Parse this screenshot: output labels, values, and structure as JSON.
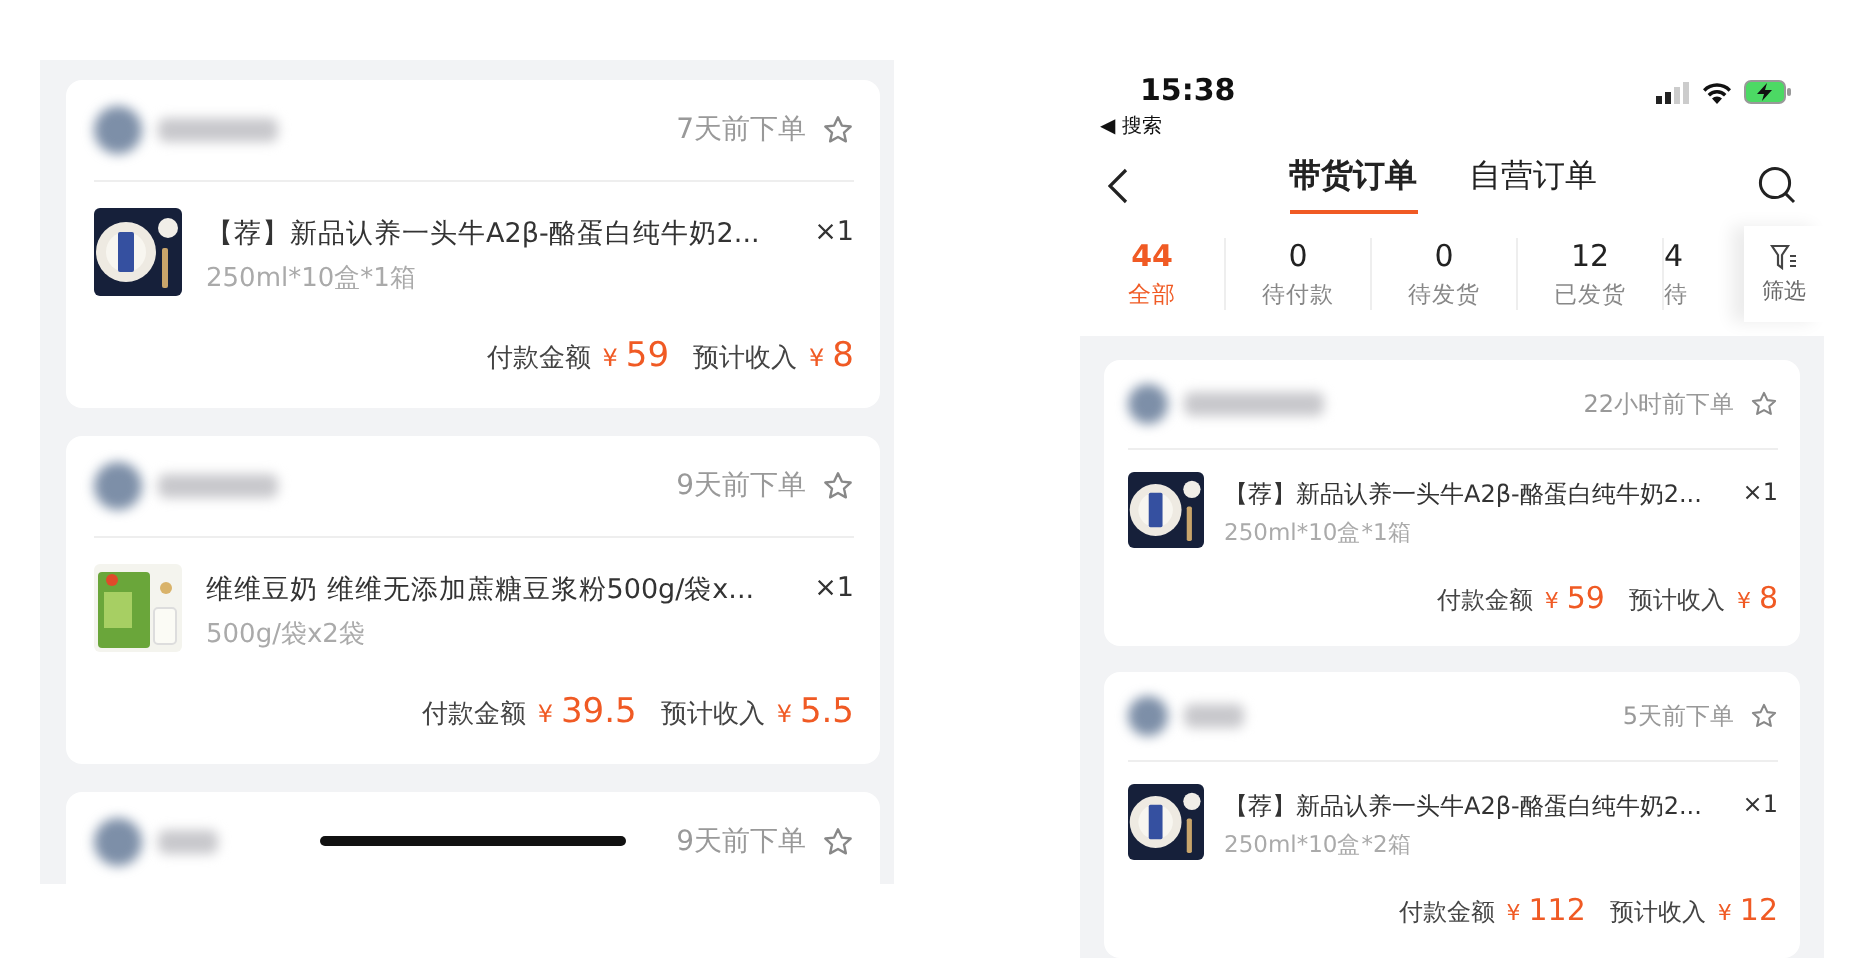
{
  "left_screen": {
    "orders": [
      {
        "time": "7天前下单",
        "items": [
          {
            "kind": "milk",
            "title": "【荐】新品认养一头牛A2β-酪蛋白纯牛奶2...",
            "qty": "×1",
            "spec": "250ml*10盒*1箱"
          }
        ],
        "pay_label": "付款金额",
        "pay_currency": "¥",
        "pay": "59",
        "income_label": "预计收入",
        "income_currency": "¥",
        "income": "8"
      },
      {
        "time": "9天前下单",
        "items": [
          {
            "kind": "soy",
            "title": "维维豆奶  维维无添加蔗糖豆浆粉500g/袋x...",
            "qty": "×1",
            "spec": "500g/袋x2袋"
          }
        ],
        "pay_label": "付款金额",
        "pay_currency": "¥",
        "pay": "39.5",
        "income_label": "预计收入",
        "income_currency": "¥",
        "income": "5.5"
      },
      {
        "time": "9天前下单"
      }
    ]
  },
  "right_screen": {
    "status_bar": {
      "time": "15:38",
      "back_app": "◀ 搜索"
    },
    "tabs": [
      {
        "label": "带货订单",
        "selected": true
      },
      {
        "label": "自营订单",
        "selected": false
      }
    ],
    "stats": [
      {
        "count": "44",
        "label": "全部",
        "selected": true
      },
      {
        "count": "0",
        "label": "待付款",
        "selected": false
      },
      {
        "count": "0",
        "label": "待发货",
        "selected": false
      },
      {
        "count": "12",
        "label": "已发货",
        "selected": false
      },
      {
        "count": "4",
        "label": "待",
        "selected": false
      }
    ],
    "filter": {
      "label": "筛选"
    },
    "orders": [
      {
        "time": "22小时前下单",
        "items": [
          {
            "kind": "milk",
            "title": "【荐】新品认养一头牛A2β-酪蛋白纯牛奶2...",
            "qty": "×1",
            "spec": "250ml*10盒*1箱"
          }
        ],
        "pay_label": "付款金额",
        "pay_currency": "¥",
        "pay": "59",
        "income_label": "预计收入",
        "income_currency": "¥",
        "income": "8"
      },
      {
        "time": "5天前下单",
        "items": [
          {
            "kind": "milk",
            "title": "【荐】新品认养一头牛A2β-酪蛋白纯牛奶2...",
            "qty": "×1",
            "spec": "250ml*10盒*2箱"
          }
        ],
        "pay_label": "付款金额",
        "pay_currency": "¥",
        "pay": "112",
        "income_label": "预计收入",
        "income_currency": "¥",
        "income": "12"
      }
    ]
  }
}
